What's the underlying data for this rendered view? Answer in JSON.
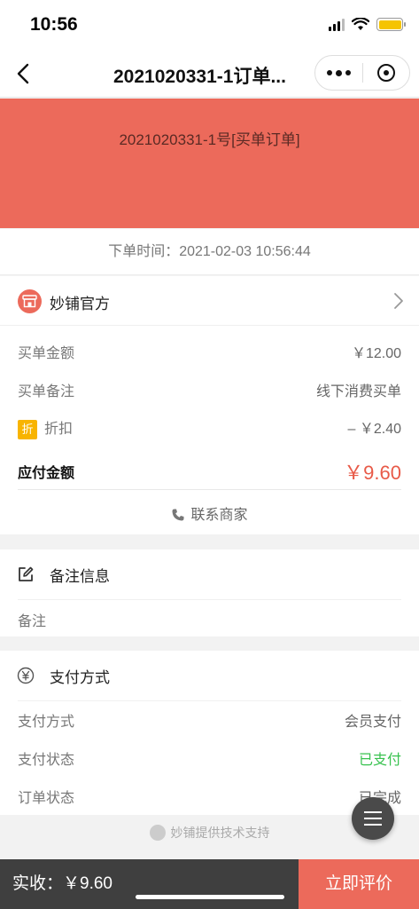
{
  "status_bar": {
    "time": "10:56"
  },
  "nav": {
    "title": "2021020331-1订单..."
  },
  "banner": {
    "text": "2021020331-1号[买单订单]"
  },
  "order_time": "下单时间：2021-02-03 10:56:44",
  "shop": {
    "name": "妙铺官方"
  },
  "order_info": {
    "amount_label": "买单金额",
    "amount_value": "￥12.00",
    "remark_label": "买单备注",
    "remark_value": "线下消费买单",
    "discount_badge": "折",
    "discount_label": "折扣",
    "discount_value": "– ￥2.40",
    "payable_label": "应付金额",
    "payable_value": "￥9.60",
    "contact_label": "联系商家"
  },
  "remark_section": {
    "title": "备注信息",
    "placeholder_label": "备注"
  },
  "payment_section": {
    "title": "支付方式",
    "method_label": "支付方式",
    "method_value": "会员支付",
    "status_label": "支付状态",
    "status_value": "已支付",
    "order_status_label": "订单状态",
    "order_status_value": "已完成"
  },
  "footer": {
    "note": "妙铺提供技术支持"
  },
  "bottom_bar": {
    "received": "实收：￥9.60",
    "review_button": "立即评价"
  },
  "colors": {
    "accent": "#ec6a5b",
    "price": "#e85a48",
    "paid_green": "#38c24f",
    "bottom_dark": "#3f3f3f"
  }
}
